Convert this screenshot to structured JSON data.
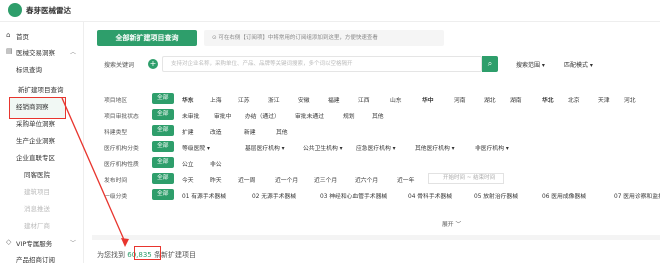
{
  "app": {
    "title": "春芽医械雷达"
  },
  "sidebar": {
    "items": [
      {
        "label": "首页",
        "icon": "home-icon"
      },
      {
        "label": "医械交易洞察",
        "icon": "chart-icon",
        "expanded": true
      },
      {
        "label": "标讯查询"
      },
      {
        "label": "新扩建项目查询"
      },
      {
        "label": "经销商洞察"
      },
      {
        "label": "采购单位洞察"
      },
      {
        "label": "生产企业洞察"
      },
      {
        "label": "企业直联专区"
      },
      {
        "label": "同客医院"
      },
      {
        "label": "建筑项目"
      },
      {
        "label": "消息推送"
      },
      {
        "label": "建材厂商"
      },
      {
        "label": "VIP专属服务"
      },
      {
        "label": "产品招商订阅"
      }
    ]
  },
  "main": {
    "tab_label": "全部新扩建项目查询",
    "notice": "可在右侧【订阅项】中将常用的订阅组添加到这里，方便快速查看",
    "search": {
      "label": "搜索关键词",
      "placeholder": "支持对企业名称，采购单位、产品、品牌等关键词搜索，多个词以空格隔开",
      "scope_label": "搜索范围",
      "match_label": "匹配模式"
    },
    "filters": [
      {
        "label": "项目地区",
        "options": [
          "华东",
          "上海",
          "江苏",
          "浙江",
          "安徽",
          "福建",
          "江西",
          "山东",
          "华中",
          "河南",
          "湖北",
          "湖南",
          "华北",
          "北京",
          "天津",
          "河北"
        ],
        "bold": [
          "华东",
          "华中",
          "华北"
        ]
      },
      {
        "label": "项目审批状态",
        "options": [
          "未审批",
          "审批中",
          "办结（通过）",
          "审批未通过",
          "规划",
          "其他"
        ]
      },
      {
        "label": "科建类型",
        "options": [
          "扩建",
          "改造",
          "新建",
          "其他"
        ]
      },
      {
        "label": "医疗机构分类",
        "options": [
          "等级医院",
          "基层医疗机构",
          "公共卫生机构",
          "应急医疗机构",
          "其他医疗机构",
          "非医疗机构"
        ]
      },
      {
        "label": "医疗机构性质",
        "options": [
          "公立",
          "非公"
        ]
      },
      {
        "label": "发布时间",
        "options": [
          "今天",
          "昨天",
          "近一周",
          "近一个月",
          "近三个月",
          "近六个月",
          "近一年"
        ]
      },
      {
        "label": "一级分类",
        "options": [
          "01 有源手术器械",
          "02 无源手术器械",
          "03 神经和心血管手术器械",
          "04 骨科手术器械",
          "05 放射治疗器械",
          "06 医用成像器械",
          "07 医用诊察和监护器械"
        ]
      }
    ],
    "all_label": "全部",
    "date_start": "开始时间",
    "date_sep": "~",
    "date_end": "结束时间",
    "expand_label": "展开",
    "result_prefix": "为您找到",
    "result_count": "60,835",
    "result_suffix": "条新扩建项目"
  }
}
